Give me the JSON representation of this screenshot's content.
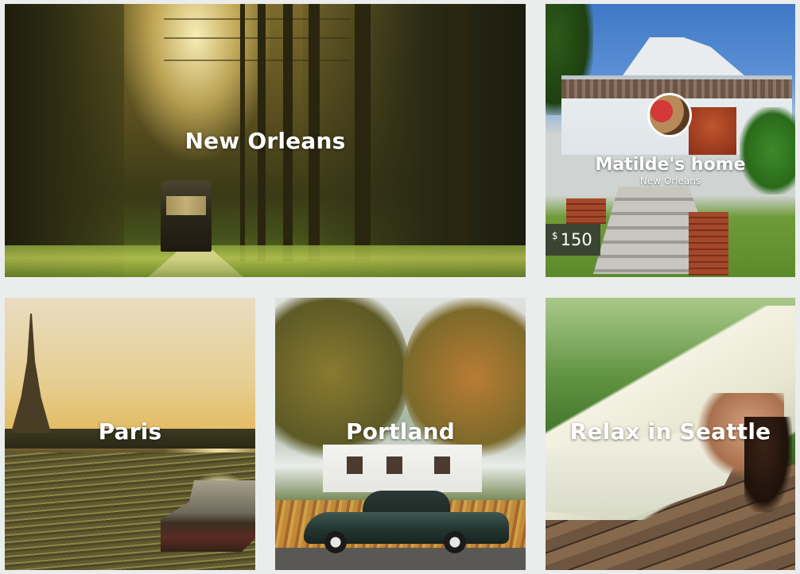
{
  "tiles": {
    "new_orleans": {
      "label": "New Orleans"
    },
    "listing": {
      "title": "Matilde's home",
      "location": "New Orleans",
      "price_currency": "$",
      "price_amount": "150"
    },
    "paris": {
      "label": "Paris"
    },
    "portland": {
      "label": "Portland"
    },
    "seattle": {
      "label": "Relax in Seattle"
    }
  },
  "colors": {
    "page_background": "#ebecec",
    "label_text": "#ffffff",
    "price_badge_background": "#323232"
  }
}
